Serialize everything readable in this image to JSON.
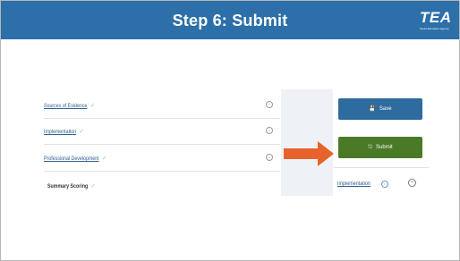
{
  "header": {
    "title": "Step 6: Submit",
    "logo_text": "TEA",
    "logo_subtitle": "Texas Education Agency",
    "color": "#2d6fa8"
  },
  "rubric": {
    "rows": [
      {
        "label": "Sources of Evidence",
        "check": "✓",
        "info": "i"
      },
      {
        "label": "Implementation",
        "check": "✓",
        "info": "i"
      },
      {
        "label": "Professional Development",
        "check": "✓",
        "info": "i"
      },
      {
        "label": "Summary Scoring",
        "check": "✓"
      }
    ]
  },
  "actions": {
    "save_label": "Save",
    "save_icon": "save-icon",
    "save_color": "#2e6b9e",
    "submit_label": "Submit",
    "submit_icon": "submit-icon",
    "submit_color": "#4a7a25",
    "arrow_color": "#e8632b"
  },
  "side": {
    "implementation_label": "Implementation",
    "implementation_badge": "i",
    "collapse_icon": "minus-circle-icon"
  }
}
